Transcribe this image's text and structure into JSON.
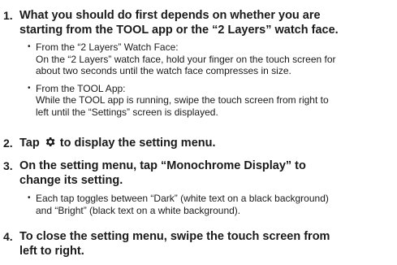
{
  "steps": [
    {
      "number": "1.",
      "title_line1": "What you should do first depends on whether you are",
      "title_line2": "starting from the TOOL app or the “2 Layers” watch face.",
      "bullets": [
        {
          "head": "From the “2 Layers” Watch Face:",
          "line1": "On the “2 Layers” watch face, hold your finger on the touch screen for",
          "line2": "about two seconds until the watch face compresses in size."
        },
        {
          "head": "From the TOOL App:",
          "line1": "While the TOOL app is running, swipe the touch screen from right to",
          "line2": "left until the “Settings” screen is displayed."
        }
      ]
    },
    {
      "number": "2.",
      "title_before": "Tap",
      "title_icon": "gear-icon",
      "title_after": "to display the setting menu."
    },
    {
      "number": "3.",
      "title_line1": "On the setting menu, tap “Monochrome Display” to",
      "title_line2": "change its setting.",
      "bullet_line1": "Each tap toggles between “Dark” (white text on a black background)",
      "bullet_line2": "and “Bright” (black text on a white background)."
    },
    {
      "number": "4.",
      "title_line1": "To close the setting menu, swipe the touch screen from",
      "title_line2": "left to right."
    }
  ],
  "bullet_glyph": "•"
}
